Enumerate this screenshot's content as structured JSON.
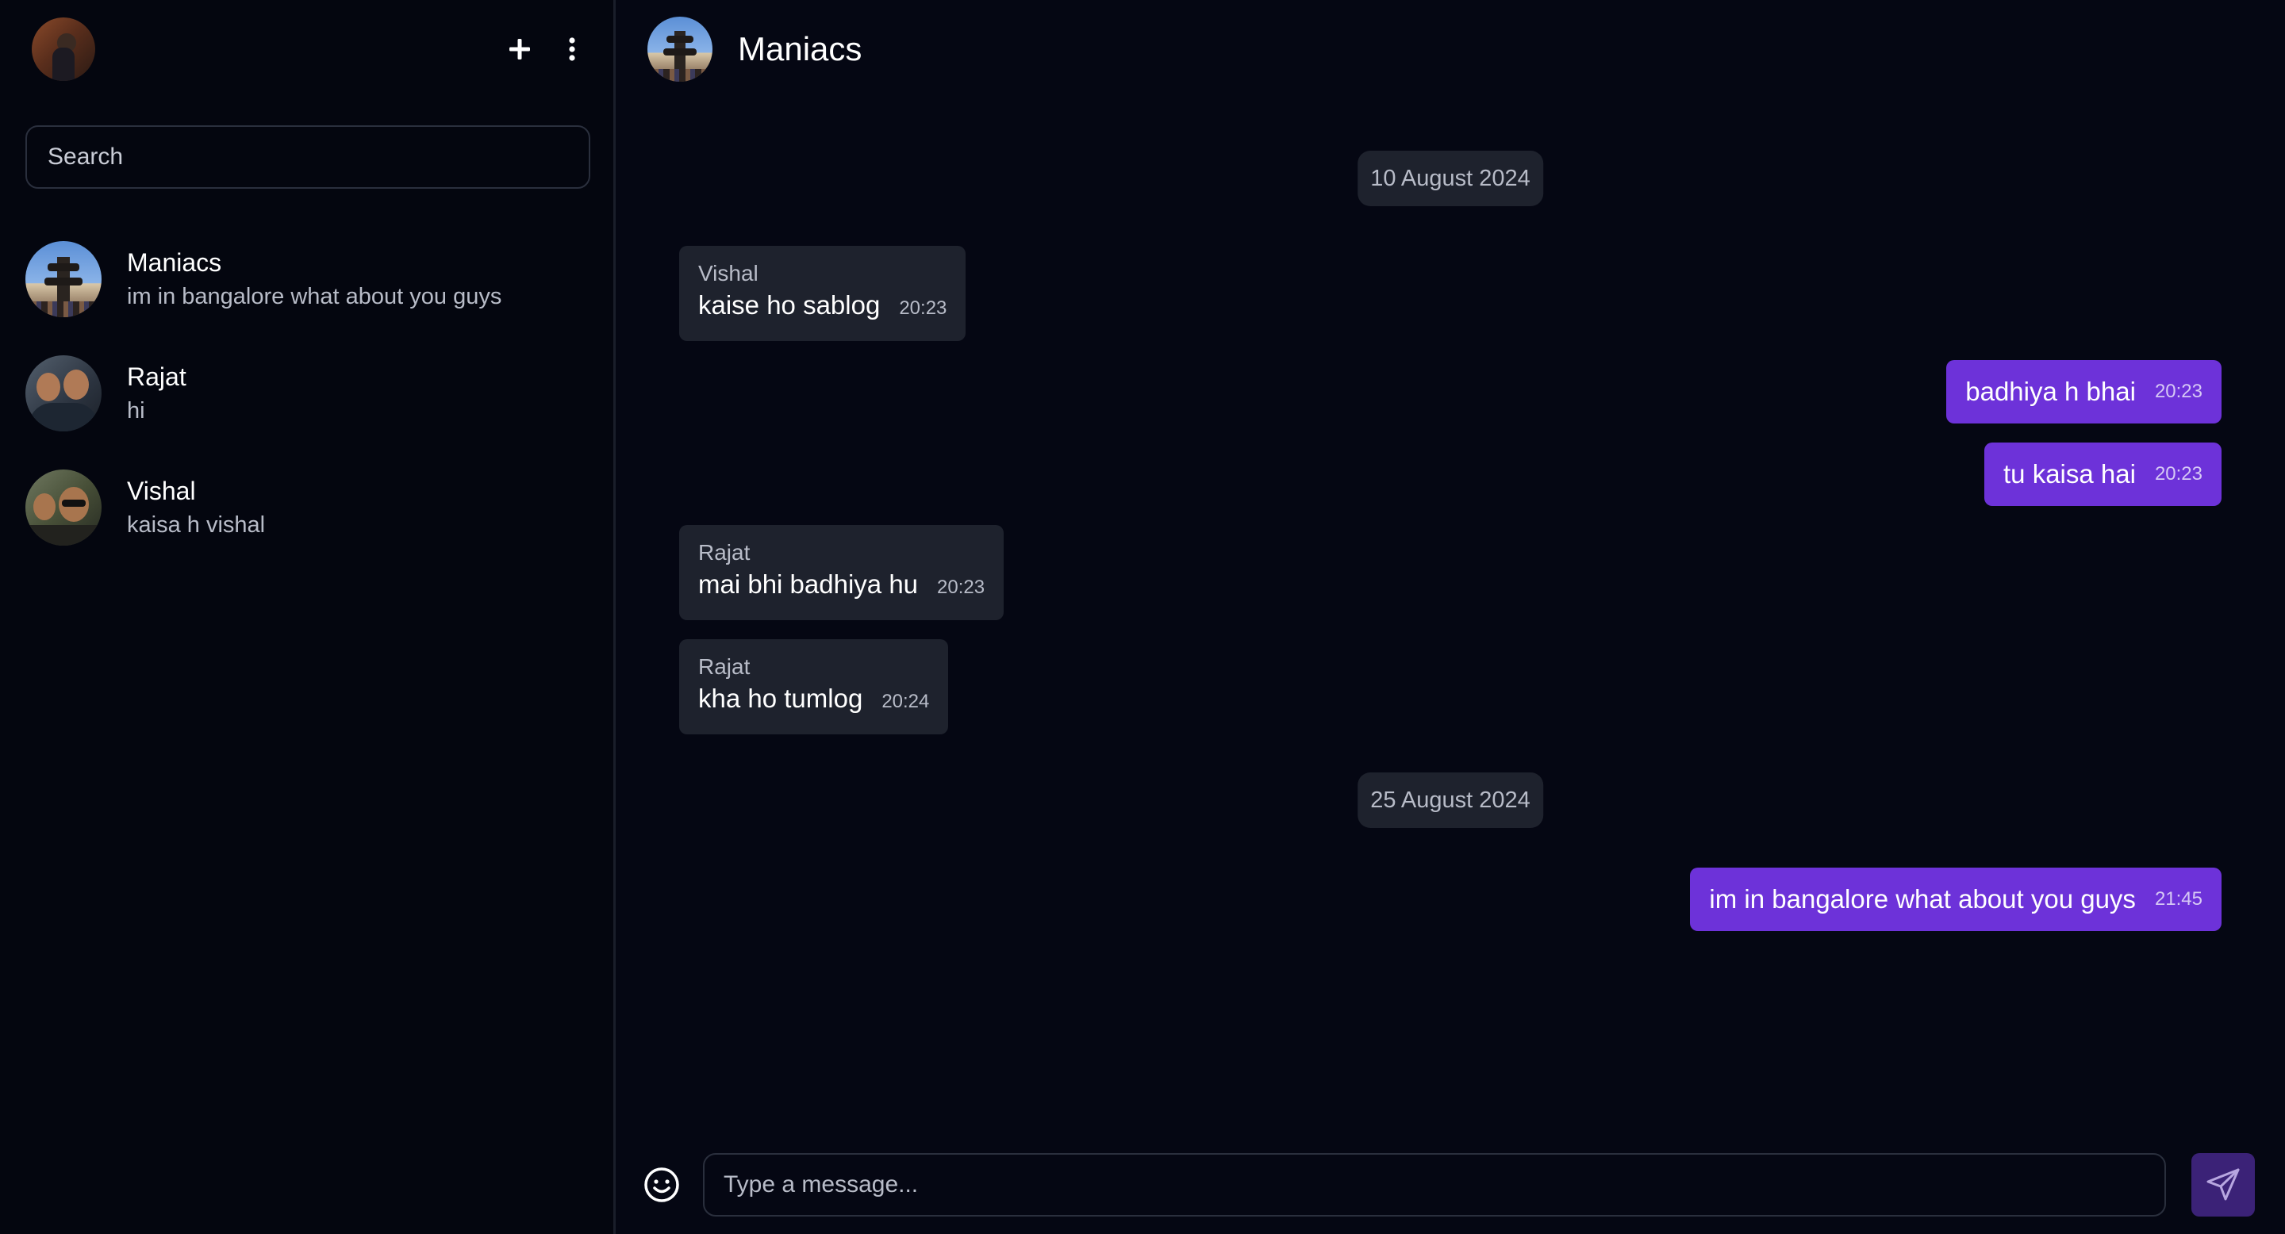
{
  "sidebar": {
    "header": {
      "profile_avatar": "user-avatar",
      "actions": [
        {
          "icon": "plus-icon"
        },
        {
          "icon": "more-vertical-icon"
        }
      ]
    },
    "search": {
      "placeholder": "Search",
      "value": ""
    },
    "chats": [
      {
        "name": "Maniacs",
        "preview": "im in bangalore what about you guys",
        "avatar": "group-photo-temple"
      },
      {
        "name": "Rajat",
        "preview": "hi",
        "avatar": "photo-two-people"
      },
      {
        "name": "Vishal",
        "preview": "kaisa h vishal",
        "avatar": "photo-two-people-sunglasses"
      }
    ]
  },
  "chat": {
    "title": "Maniacs",
    "dates": [
      "10 August 2024",
      "25 August 2024"
    ],
    "messages": [
      {
        "direction": "in",
        "sender": "Vishal",
        "text": "kaise ho sablog",
        "time": "20:23"
      },
      {
        "direction": "out",
        "text": "badhiya h bhai",
        "time": "20:23"
      },
      {
        "direction": "out",
        "text": "tu kaisa hai",
        "time": "20:23"
      },
      {
        "direction": "in",
        "sender": "Rajat",
        "text": "mai bhi badhiya hu",
        "time": "20:23"
      },
      {
        "direction": "in",
        "sender": "Rajat",
        "text": "kha ho tumlog",
        "time": "20:24"
      },
      {
        "direction": "out",
        "text": "im in bangalore what about you guys",
        "time": "21:45"
      }
    ],
    "composer": {
      "placeholder": "Type a message...",
      "value": "",
      "emoji_icon": "smiley-icon",
      "send_icon": "send-icon"
    }
  },
  "colors": {
    "background": "#050713",
    "bubble_in": "#1e222d",
    "bubble_out": "#6d32d9",
    "send_button": "#3b2277"
  }
}
